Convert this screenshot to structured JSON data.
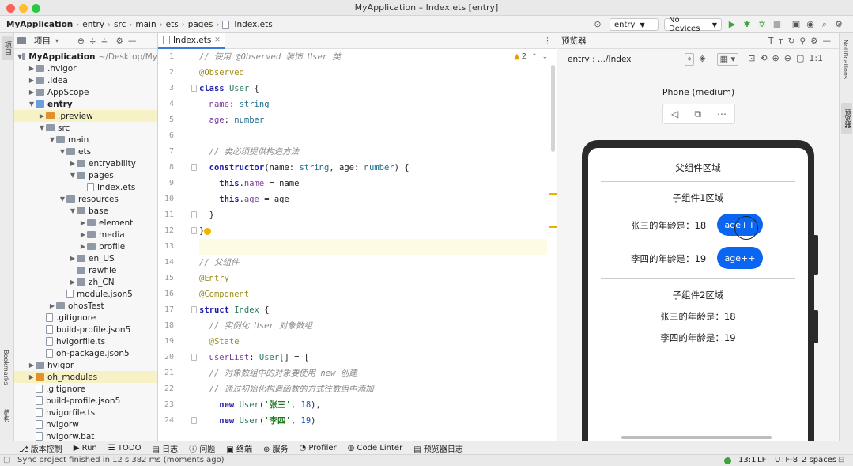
{
  "window": {
    "title": "MyApplication – Index.ets [entry]"
  },
  "navbar": {
    "breadcrumbs": [
      "MyApplication",
      "entry",
      "src",
      "main",
      "ets",
      "pages",
      "Index.ets"
    ],
    "module_select": "entry",
    "device_select": "No Devices"
  },
  "project_panel": {
    "title": "项目",
    "tree": [
      {
        "label": "MyApplication",
        "suffix": "~/Desktop/My",
        "depth": 0,
        "arrow": "down",
        "icon": "folder",
        "bold": true
      },
      {
        "label": ".hvigor",
        "depth": 1,
        "arrow": "right",
        "icon": "folder"
      },
      {
        "label": ".idea",
        "depth": 1,
        "arrow": "right",
        "icon": "folder"
      },
      {
        "label": "AppScope",
        "depth": 1,
        "arrow": "right",
        "icon": "folder"
      },
      {
        "label": "entry",
        "depth": 1,
        "arrow": "down",
        "icon": "folder-blue",
        "bold": true
      },
      {
        "label": ".preview",
        "depth": 2,
        "arrow": "right",
        "icon": "folder-orange",
        "highlight": true
      },
      {
        "label": "src",
        "depth": 2,
        "arrow": "down",
        "icon": "folder"
      },
      {
        "label": "main",
        "depth": 3,
        "arrow": "down",
        "icon": "folder"
      },
      {
        "label": "ets",
        "depth": 4,
        "arrow": "down",
        "icon": "folder"
      },
      {
        "label": "entryability",
        "depth": 5,
        "arrow": "right",
        "icon": "folder"
      },
      {
        "label": "pages",
        "depth": 5,
        "arrow": "down",
        "icon": "folder"
      },
      {
        "label": "Index.ets",
        "depth": 6,
        "arrow": "",
        "icon": "file"
      },
      {
        "label": "resources",
        "depth": 4,
        "arrow": "down",
        "icon": "folder"
      },
      {
        "label": "base",
        "depth": 5,
        "arrow": "down",
        "icon": "folder"
      },
      {
        "label": "element",
        "depth": 6,
        "arrow": "right",
        "icon": "folder"
      },
      {
        "label": "media",
        "depth": 6,
        "arrow": "right",
        "icon": "folder"
      },
      {
        "label": "profile",
        "depth": 6,
        "arrow": "right",
        "icon": "folder"
      },
      {
        "label": "en_US",
        "depth": 5,
        "arrow": "right",
        "icon": "folder"
      },
      {
        "label": "rawfile",
        "depth": 5,
        "arrow": "",
        "icon": "folder"
      },
      {
        "label": "zh_CN",
        "depth": 5,
        "arrow": "right",
        "icon": "folder"
      },
      {
        "label": "module.json5",
        "depth": 4,
        "arrow": "",
        "icon": "file"
      },
      {
        "label": "ohosTest",
        "depth": 3,
        "arrow": "right",
        "icon": "folder"
      },
      {
        "label": ".gitignore",
        "depth": 2,
        "arrow": "",
        "icon": "file"
      },
      {
        "label": "build-profile.json5",
        "depth": 2,
        "arrow": "",
        "icon": "file"
      },
      {
        "label": "hvigorfile.ts",
        "depth": 2,
        "arrow": "",
        "icon": "file"
      },
      {
        "label": "oh-package.json5",
        "depth": 2,
        "arrow": "",
        "icon": "file"
      },
      {
        "label": "hvigor",
        "depth": 1,
        "arrow": "right",
        "icon": "folder"
      },
      {
        "label": "oh_modules",
        "depth": 1,
        "arrow": "right",
        "icon": "folder-orange",
        "highlight": true
      },
      {
        "label": ".gitignore",
        "depth": 1,
        "arrow": "",
        "icon": "file"
      },
      {
        "label": "build-profile.json5",
        "depth": 1,
        "arrow": "",
        "icon": "file"
      },
      {
        "label": "hvigorfile.ts",
        "depth": 1,
        "arrow": "",
        "icon": "file"
      },
      {
        "label": "hvigorw",
        "depth": 1,
        "arrow": "",
        "icon": "file"
      },
      {
        "label": "hvigorw.bat",
        "depth": 1,
        "arrow": "",
        "icon": "file"
      }
    ]
  },
  "left_strip": {
    "top_label": "项目",
    "bookmarks": "Bookmarks",
    "structure": "结构"
  },
  "editor": {
    "tab": "Index.ets",
    "warning_count": "2",
    "current_line": 13,
    "lines": [
      {
        "n": "1",
        "segs": [
          {
            "t": "// 使用 @Observed 装饰 User 类",
            "c": "com"
          }
        ]
      },
      {
        "n": "2",
        "segs": [
          {
            "t": "@Observed",
            "c": "ann"
          }
        ]
      },
      {
        "n": "3",
        "segs": [
          {
            "t": "class ",
            "c": "kw"
          },
          {
            "t": "User",
            "c": "cls"
          },
          {
            "t": " {",
            "c": ""
          }
        ]
      },
      {
        "n": "4",
        "segs": [
          {
            "t": "  name",
            "c": "prop"
          },
          {
            "t": ": ",
            "c": ""
          },
          {
            "t": "string",
            "c": "type"
          }
        ]
      },
      {
        "n": "5",
        "segs": [
          {
            "t": "  age",
            "c": "prop"
          },
          {
            "t": ": ",
            "c": ""
          },
          {
            "t": "number",
            "c": "type"
          }
        ]
      },
      {
        "n": "6",
        "segs": [
          {
            "t": "",
            "c": ""
          }
        ]
      },
      {
        "n": "7",
        "segs": [
          {
            "t": "  // 类必须提供构造方法",
            "c": "com"
          }
        ]
      },
      {
        "n": "8",
        "segs": [
          {
            "t": "  constructor",
            "c": "kw"
          },
          {
            "t": "(name: ",
            "c": ""
          },
          {
            "t": "string",
            "c": "type"
          },
          {
            "t": ", age: ",
            "c": ""
          },
          {
            "t": "number",
            "c": "type"
          },
          {
            "t": ") {",
            "c": ""
          }
        ]
      },
      {
        "n": "9",
        "segs": [
          {
            "t": "    this",
            "c": "kw"
          },
          {
            "t": ".",
            "c": ""
          },
          {
            "t": "name",
            "c": "prop"
          },
          {
            "t": " = name",
            "c": ""
          }
        ]
      },
      {
        "n": "10",
        "segs": [
          {
            "t": "    this",
            "c": "kw"
          },
          {
            "t": ".",
            "c": ""
          },
          {
            "t": "age",
            "c": "prop"
          },
          {
            "t": " = age",
            "c": ""
          }
        ]
      },
      {
        "n": "11",
        "segs": [
          {
            "t": "  }",
            "c": ""
          }
        ]
      },
      {
        "n": "12",
        "segs": [
          {
            "t": "}",
            "c": ""
          }
        ]
      },
      {
        "n": "13",
        "segs": [
          {
            "t": "",
            "c": ""
          }
        ]
      },
      {
        "n": "14",
        "segs": [
          {
            "t": "// 父组件",
            "c": "com"
          }
        ]
      },
      {
        "n": "15",
        "segs": [
          {
            "t": "@Entry",
            "c": "ann"
          }
        ]
      },
      {
        "n": "16",
        "segs": [
          {
            "t": "@Component",
            "c": "ann"
          }
        ]
      },
      {
        "n": "17",
        "segs": [
          {
            "t": "struct ",
            "c": "kw"
          },
          {
            "t": "Index",
            "c": "cls"
          },
          {
            "t": " {",
            "c": ""
          }
        ]
      },
      {
        "n": "18",
        "segs": [
          {
            "t": "  // 实例化 User 对象数组",
            "c": "com"
          }
        ]
      },
      {
        "n": "19",
        "segs": [
          {
            "t": "  @State",
            "c": "ann"
          }
        ]
      },
      {
        "n": "20",
        "segs": [
          {
            "t": "  userList",
            "c": "prop"
          },
          {
            "t": ": ",
            "c": ""
          },
          {
            "t": "User",
            "c": "cls"
          },
          {
            "t": "[] = [",
            "c": ""
          }
        ]
      },
      {
        "n": "21",
        "segs": [
          {
            "t": "  // 对象数组中的对象要使用 new 创建",
            "c": "com"
          }
        ]
      },
      {
        "n": "22",
        "segs": [
          {
            "t": "  // 通过初始化构造函数的方式往数组中添加",
            "c": "com"
          }
        ]
      },
      {
        "n": "23",
        "segs": [
          {
            "t": "    new ",
            "c": "kw"
          },
          {
            "t": "User",
            "c": "cls"
          },
          {
            "t": "(",
            "c": ""
          },
          {
            "t": "'张三'",
            "c": "str"
          },
          {
            "t": ", ",
            "c": ""
          },
          {
            "t": "18",
            "c": "num"
          },
          {
            "t": "),",
            "c": ""
          }
        ]
      },
      {
        "n": "24",
        "segs": [
          {
            "t": "    new ",
            "c": "kw"
          },
          {
            "t": "User",
            "c": "cls"
          },
          {
            "t": "(",
            "c": ""
          },
          {
            "t": "'李四'",
            "c": "str"
          },
          {
            "t": ", ",
            "c": ""
          },
          {
            "t": "19",
            "c": "num"
          },
          {
            "t": ")",
            "c": ""
          }
        ]
      }
    ]
  },
  "preview": {
    "panel_title": "预览器",
    "route": "entry : .../Index",
    "device_name": "Phone (medium)",
    "parent_title": "父组件区域",
    "child1_title": "子组件1区域",
    "row1_label": "张三的年龄是：18",
    "row2_label": "李四的年龄是：19",
    "button_label": "age++",
    "child2_title": "子组件2区域",
    "child2_row1": "张三的年龄是：18",
    "child2_row2": "李四的年龄是：19"
  },
  "right_strip": {
    "notifications": "Notifications",
    "previewer": "预览器"
  },
  "bottom_tabs": [
    "版本控制",
    "Run",
    "TODO",
    "日志",
    "问题",
    "终端",
    "服务",
    "Profiler",
    "Code Linter",
    "预览器日志"
  ],
  "status": {
    "message": "Sync project finished in 12 s 382 ms (moments ago)",
    "position": "13:1",
    "line_sep": "LF",
    "encoding": "UTF-8",
    "indent": "2 spaces"
  },
  "colors": {
    "accent": "#3a7bd5",
    "button_blue": "#0a66f0",
    "run_green": "#3aa53a"
  }
}
